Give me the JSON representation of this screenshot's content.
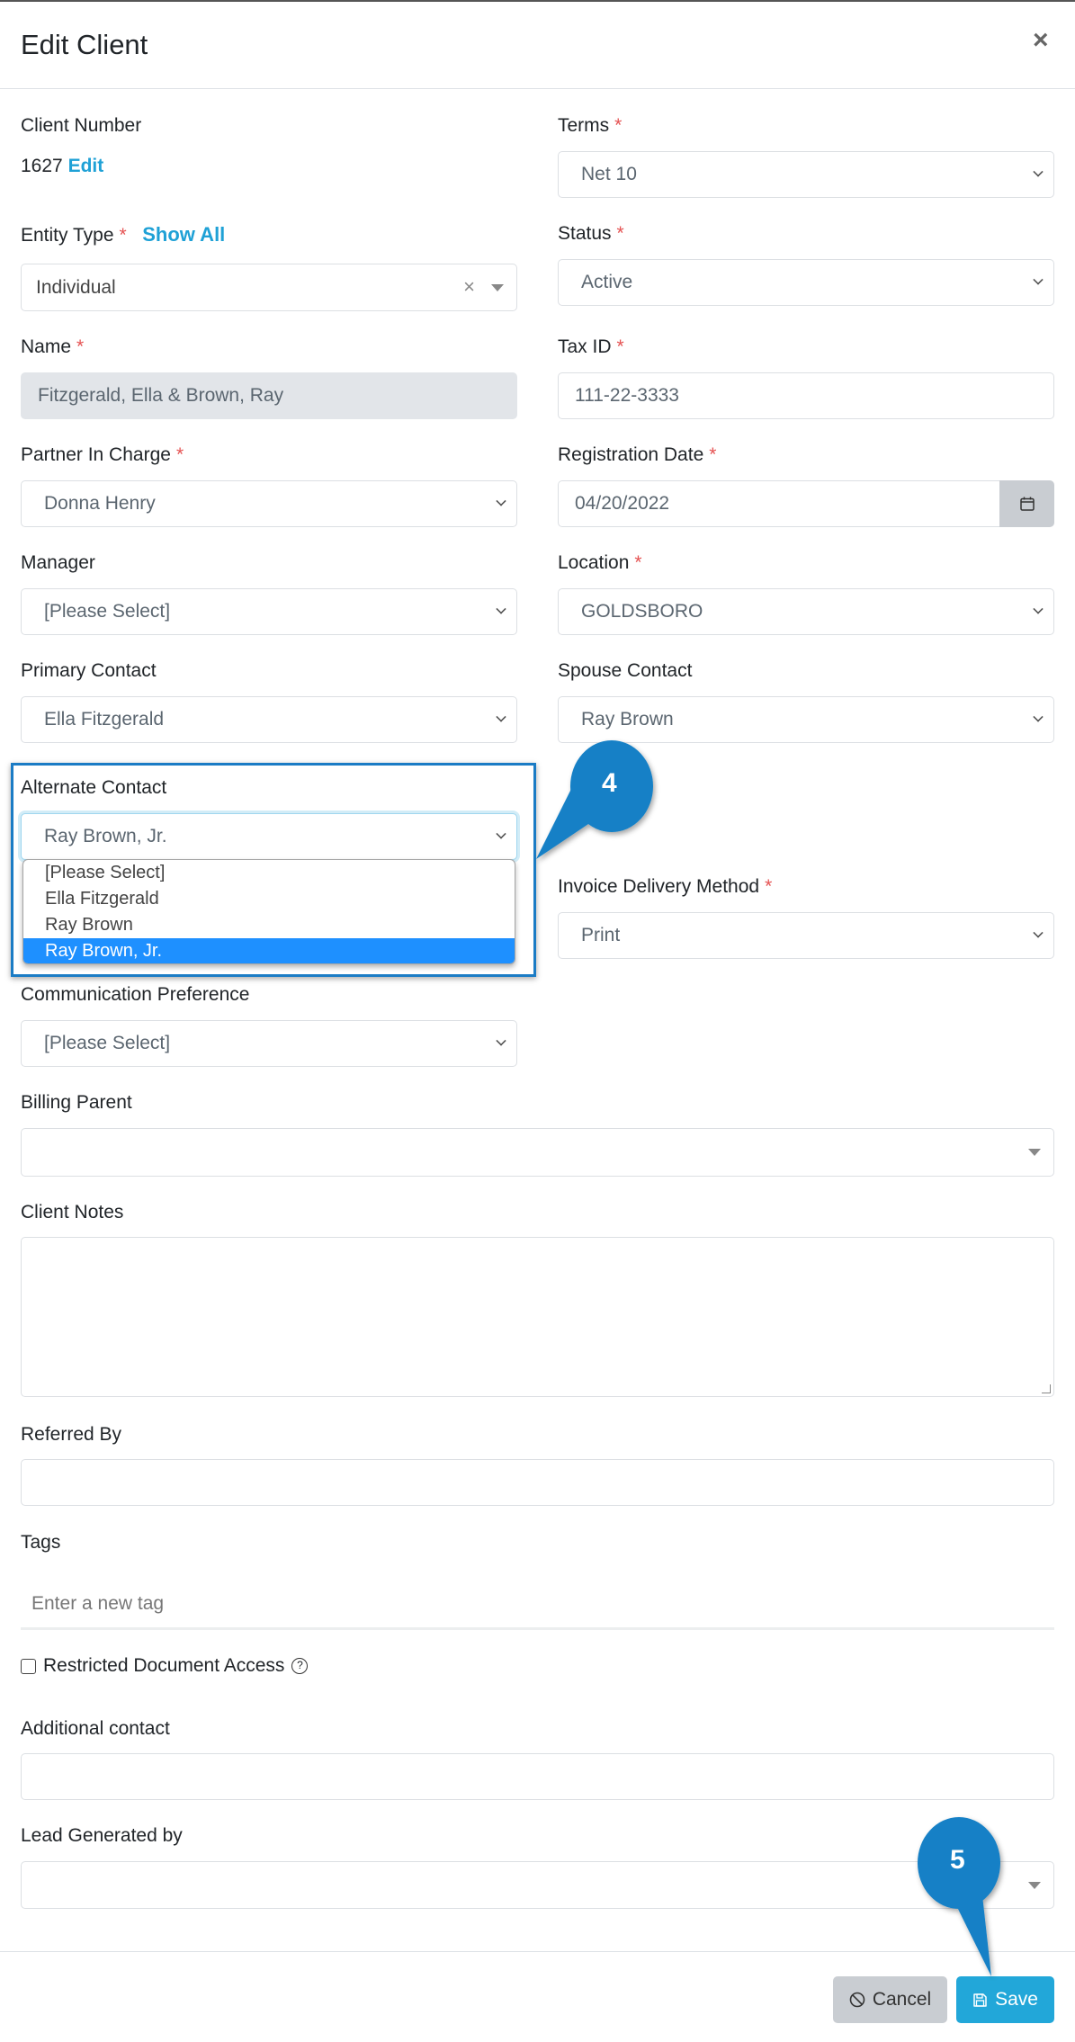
{
  "dialog": {
    "title": "Edit Client",
    "close_icon": "close-icon"
  },
  "fields": {
    "client_number": {
      "label": "Client Number",
      "value": "1627",
      "edit_link": "Edit"
    },
    "terms": {
      "label": "Terms",
      "required": "*",
      "value": "Net 10"
    },
    "entity_type": {
      "label": "Entity Type",
      "required": "*",
      "show_all": "Show All",
      "value": "Individual",
      "clear": "×"
    },
    "status": {
      "label": "Status",
      "required": "*",
      "value": "Active"
    },
    "name": {
      "label": "Name",
      "required": "*",
      "value": "Fitzgerald, Ella & Brown, Ray"
    },
    "tax_id": {
      "label": "Tax ID",
      "required": "*",
      "value": "111-22-3333"
    },
    "partner_in_charge": {
      "label": "Partner In Charge",
      "required": "*",
      "value": "Donna Henry"
    },
    "registration_date": {
      "label": "Registration Date",
      "required": "*",
      "value": "04/20/2022"
    },
    "manager": {
      "label": "Manager",
      "value": "[Please Select]"
    },
    "location": {
      "label": "Location",
      "required": "*",
      "value": "GOLDSBORO"
    },
    "primary_contact": {
      "label": "Primary Contact",
      "value": "Ella Fitzgerald"
    },
    "spouse_contact": {
      "label": "Spouse Contact",
      "value": "Ray Brown"
    },
    "alternate_contact": {
      "label": "Alternate Contact",
      "value": "Ray Brown, Jr.",
      "options": [
        "[Please Select]",
        "Ella Fitzgerald",
        "Ray Brown",
        "Ray Brown, Jr."
      ],
      "selected_index": 3
    },
    "invoice_delivery_method": {
      "label": "Invoice Delivery Method",
      "required": "*",
      "value": "Print"
    },
    "communication_preference": {
      "label": "Communication Preference",
      "value": "[Please Select]"
    },
    "billing_parent": {
      "label": "Billing Parent",
      "value": ""
    },
    "client_notes": {
      "label": "Client Notes",
      "value": ""
    },
    "referred_by": {
      "label": "Referred By",
      "value": ""
    },
    "tags": {
      "label": "Tags",
      "placeholder": "Enter a new tag"
    },
    "restricted_document_access": {
      "label": "Restricted Document Access",
      "checked": false,
      "help": "?"
    },
    "additional_contact": {
      "label": "Additional contact",
      "value": ""
    },
    "lead_generated_by": {
      "label": "Lead Generated by",
      "value": ""
    }
  },
  "footer": {
    "cancel_label": "Cancel",
    "save_label": "Save"
  },
  "annotations": {
    "callout_4": "4",
    "callout_5": "5",
    "callout_color": "#1380c6"
  }
}
